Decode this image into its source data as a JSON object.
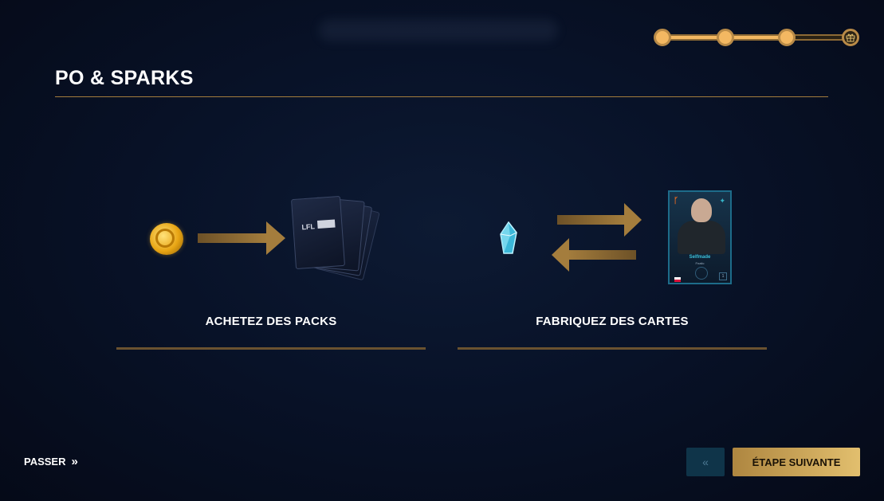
{
  "header": {
    "title": "PO & SPARKS"
  },
  "progress": {
    "steps_total": 4,
    "steps_completed": 3,
    "final_icon": "gift-icon"
  },
  "sections": [
    {
      "label": "ACHETEZ DES PACKS",
      "left_icon": "coin-icon",
      "right_icon": "card-packs-icon"
    },
    {
      "label": "FABRIQUEZ DES CARTES",
      "left_icon": "spark-crystal-icon",
      "right_icon": "player-card-icon"
    }
  ],
  "packs": {
    "brand": "LFL"
  },
  "player_card": {
    "team_mark": "ᚴ",
    "name": "Selfmade",
    "team": "Fnatic",
    "number": "1"
  },
  "footer": {
    "skip_label": "PASSER",
    "skip_icon": "»",
    "back_label": "«",
    "next_label": "ÉTAPE SUIVANTE"
  },
  "colors": {
    "accent_gold": "#e2bf6e",
    "rule_gold": "#a47d3d",
    "background": "#081228"
  }
}
